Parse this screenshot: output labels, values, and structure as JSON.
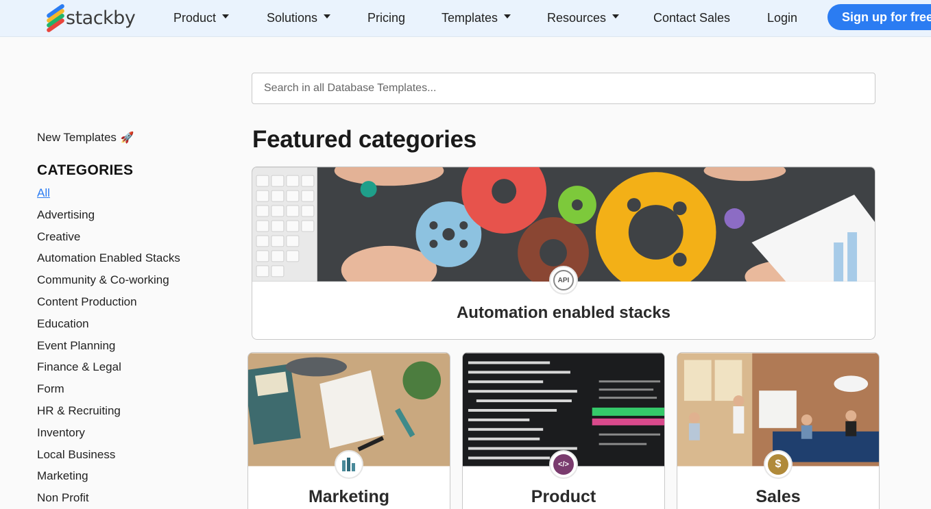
{
  "header": {
    "brand": "stackby",
    "nav": [
      {
        "label": "Product",
        "dropdown": true
      },
      {
        "label": "Solutions",
        "dropdown": true
      },
      {
        "label": "Pricing",
        "dropdown": false
      },
      {
        "label": "Templates",
        "dropdown": true
      },
      {
        "label": "Resources",
        "dropdown": true
      },
      {
        "label": "Contact Sales",
        "dropdown": false
      },
      {
        "label": "Login",
        "dropdown": false
      }
    ],
    "signup_label": "Sign up for free"
  },
  "search": {
    "placeholder": "Search in all Database Templates...",
    "value": ""
  },
  "sidebar": {
    "new_templates_label": "New Templates",
    "new_templates_icon": "rocket-icon",
    "categories_heading": "CATEGORIES",
    "categories": [
      {
        "label": "All",
        "active": true
      },
      {
        "label": "Advertising",
        "active": false
      },
      {
        "label": "Creative",
        "active": false
      },
      {
        "label": "Automation Enabled Stacks",
        "active": false
      },
      {
        "label": "Community & Co-working",
        "active": false
      },
      {
        "label": "Content Production",
        "active": false
      },
      {
        "label": "Education",
        "active": false
      },
      {
        "label": "Event Planning",
        "active": false
      },
      {
        "label": "Finance & Legal",
        "active": false
      },
      {
        "label": "Form",
        "active": false
      },
      {
        "label": "HR & Recruiting",
        "active": false
      },
      {
        "label": "Inventory",
        "active": false
      },
      {
        "label": "Local Business",
        "active": false
      },
      {
        "label": "Marketing",
        "active": false
      },
      {
        "label": "Non Profit",
        "active": false
      }
    ]
  },
  "main": {
    "featured_title": "Featured categories",
    "featured_card": {
      "title": "Automation enabled stacks",
      "badge_text": "API",
      "badge_icon": "api-gear-icon"
    },
    "cards": [
      {
        "title": "Marketing",
        "badge_icon": "marketing-chart-icon"
      },
      {
        "title": "Product",
        "badge_icon": "code-icon",
        "badge_text": "</>"
      },
      {
        "title": "Sales",
        "badge_icon": "dollar-icon",
        "badge_text": "$"
      }
    ]
  },
  "colors": {
    "accent": "#2b7cf2",
    "header_bg": "#eaf3fd",
    "page_bg": "#fafafa"
  }
}
